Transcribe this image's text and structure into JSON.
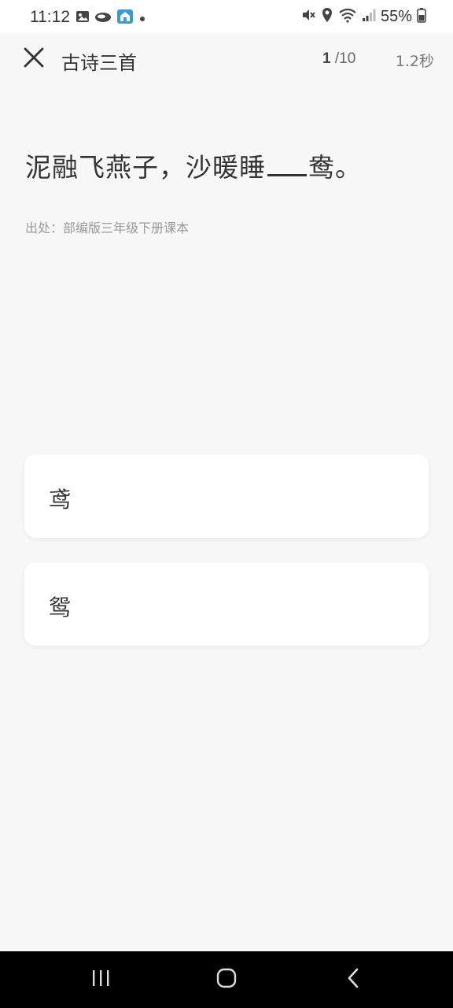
{
  "status_bar": {
    "time": "11:12",
    "battery": "55%",
    "icons_left": [
      "gallery-icon",
      "cloud-icon",
      "app-icon",
      "dot-icon"
    ],
    "icons_right": [
      "mute-icon",
      "location-icon",
      "wifi-icon",
      "signal-icon",
      "battery-icon"
    ]
  },
  "header": {
    "title": "古诗三首",
    "progress_current": "1",
    "progress_total": " /10",
    "timer": "1.2秒"
  },
  "question": {
    "text_before": "泥融飞燕子，沙暖睡",
    "text_after": "鸯。",
    "source": "出处：部编版三年级下册课本"
  },
  "options": [
    {
      "label": "鸢"
    },
    {
      "label": "鸳"
    }
  ],
  "colors": {
    "background": "#f7f7f7",
    "card": "#ffffff",
    "text": "#333333",
    "muted": "#999999",
    "nav_bar": "#000000"
  }
}
